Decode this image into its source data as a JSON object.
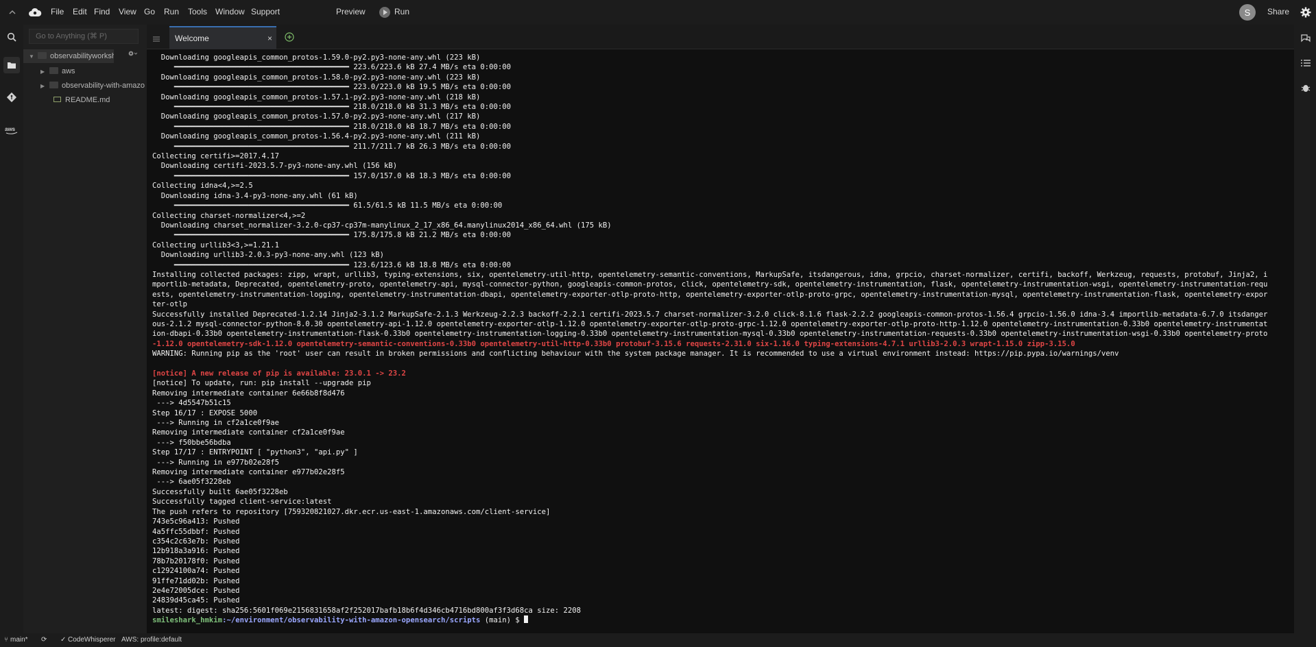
{
  "menubar": {
    "items": [
      "File",
      "Edit",
      "Find",
      "View",
      "Go",
      "Run",
      "Tools",
      "Window",
      "Support"
    ],
    "preview": "Preview",
    "run": "Run",
    "avatar_initial": "S",
    "share": "Share"
  },
  "tree": {
    "goto_placeholder": "Go to Anything (⌘ P)",
    "root": "observabilityworksh",
    "items": [
      "aws",
      "observability-with-amazo",
      "README.md"
    ]
  },
  "tabs": [
    {
      "label": "Welcome",
      "close": "×"
    }
  ],
  "terminal": {
    "lines": [
      "  Downloading googleapis_common_protos-1.59.0-py2.py3-none-any.whl (223 kB)",
      "     ━━━━━━━━━━━━━━━━━━━━━━━━━━━━━━━━━━━━━━━━ 223.6/223.6 kB 27.4 MB/s eta 0:00:00",
      "  Downloading googleapis_common_protos-1.58.0-py2.py3-none-any.whl (223 kB)",
      "     ━━━━━━━━━━━━━━━━━━━━━━━━━━━━━━━━━━━━━━━━ 223.0/223.0 kB 19.5 MB/s eta 0:00:00",
      "  Downloading googleapis_common_protos-1.57.1-py2.py3-none-any.whl (218 kB)",
      "     ━━━━━━━━━━━━━━━━━━━━━━━━━━━━━━━━━━━━━━━━ 218.0/218.0 kB 31.3 MB/s eta 0:00:00",
      "  Downloading googleapis_common_protos-1.57.0-py2.py3-none-any.whl (217 kB)",
      "     ━━━━━━━━━━━━━━━━━━━━━━━━━━━━━━━━━━━━━━━━ 218.0/218.0 kB 18.7 MB/s eta 0:00:00",
      "  Downloading googleapis_common_protos-1.56.4-py2.py3-none-any.whl (211 kB)",
      "     ━━━━━━━━━━━━━━━━━━━━━━━━━━━━━━━━━━━━━━━━ 211.7/211.7 kB 26.3 MB/s eta 0:00:00",
      "Collecting certifi>=2017.4.17",
      "  Downloading certifi-2023.5.7-py3-none-any.whl (156 kB)",
      "     ━━━━━━━━━━━━━━━━━━━━━━━━━━━━━━━━━━━━━━━━ 157.0/157.0 kB 18.3 MB/s eta 0:00:00",
      "Collecting idna<4,>=2.5",
      "  Downloading idna-3.4-py3-none-any.whl (61 kB)",
      "     ━━━━━━━━━━━━━━━━━━━━━━━━━━━━━━━━━━━━━━━━ 61.5/61.5 kB 11.5 MB/s eta 0:00:00",
      "Collecting charset-normalizer<4,>=2",
      "  Downloading charset_normalizer-3.2.0-cp37-cp37m-manylinux_2_17_x86_64.manylinux2014_x86_64.whl (175 kB)",
      "     ━━━━━━━━━━━━━━━━━━━━━━━━━━━━━━━━━━━━━━━━ 175.8/175.8 kB 21.2 MB/s eta 0:00:00",
      "Collecting urllib3<3,>=1.21.1",
      "  Downloading urllib3-2.0.3-py3-none-any.whl (123 kB)",
      "     ━━━━━━━━━━━━━━━━━━━━━━━━━━━━━━━━━━━━━━━━ 123.6/123.6 kB 18.8 MB/s eta 0:00:00",
      "Installing collected packages: zipp, wrapt, urllib3, typing-extensions, six, opentelemetry-util-http, opentelemetry-semantic-conventions, MarkupSafe, itsdangerous, idna, grpcio, charset-normalizer, certifi, backoff, Werkzeug, requests, protobuf, Jinja2, i",
      "mportlib-metadata, Deprecated, opentelemetry-proto, opentelemetry-api, mysql-connector-python, googleapis-common-protos, click, opentelemetry-sdk, opentelemetry-instrumentation, flask, opentelemetry-instrumentation-wsgi, opentelemetry-instrumentation-requ",
      "ests, opentelemetry-instrumentation-logging, opentelemetry-instrumentation-dbapi, opentelemetry-exporter-otlp-proto-http, opentelemetry-exporter-otlp-proto-grpc, opentelemetry-instrumentation-mysql, opentelemetry-instrumentation-flask, opentelemetry-expor",
      "ter-otlp",
      "Successfully installed Deprecated-1.2.14 Jinja2-3.1.2 MarkupSafe-2.1.3 Werkzeug-2.2.3 backoff-2.2.1 certifi-2023.5.7 charset-normalizer-3.2.0 click-8.1.6 flask-2.2.2 googleapis-common-protos-1.56.4 grpcio-1.56.0 idna-3.4 importlib-metadata-6.7.0 itsdanger",
      "ous-2.1.2 mysql-connector-python-8.0.30 opentelemetry-api-1.12.0 opentelemetry-exporter-otlp-1.12.0 opentelemetry-exporter-otlp-proto-grpc-1.12.0 opentelemetry-exporter-otlp-proto-http-1.12.0 opentelemetry-instrumentation-0.33b0 opentelemetry-instrumentat",
      "ion-dbapi-0.33b0 opentelemetry-instrumentation-flask-0.33b0 opentelemetry-instrumentation-logging-0.33b0 opentelemetry-instrumentation-mysql-0.33b0 opentelemetry-instrumentation-requests-0.33b0 opentelemetry-instrumentation-wsgi-0.33b0 opentelemetry-proto",
      "-1.12.0 opentelemetry-sdk-1.12.0 opentelemetry-semantic-conventions-0.33b0 opentelemetry-util-http-0.33b0 protobuf-3.15.6 requests-2.31.0 six-1.16.0 typing-extensions-4.7.1 urllib3-2.0.3 wrapt-1.15.0 zipp-3.15.0",
      "WARNING: Running pip as the 'root' user can result in broken permissions and conflicting behaviour with the system package manager. It is recommended to use a virtual environment instead: https://pip.pypa.io/warnings/venv",
      "",
      "[notice] A new release of pip is available: 23.0.1 -> 23.2",
      "[notice] To update, run: pip install --upgrade pip",
      "Removing intermediate container 6e66b8f8d476",
      " ---> 4d5547b51c15",
      "Step 16/17 : EXPOSE 5000",
      " ---> Running in cf2a1ce0f9ae",
      "Removing intermediate container cf2a1ce0f9ae",
      " ---> f50bbe56bdba",
      "Step 17/17 : ENTRYPOINT [ \"python3\", \"api.py\" ]",
      " ---> Running in e977b02e28f5",
      "Removing intermediate container e977b02e28f5",
      " ---> 6ae05f3228eb",
      "Successfully built 6ae05f3228eb",
      "Successfully tagged client-service:latest",
      "The push refers to repository [759320821027.dkr.ecr.us-east-1.amazonaws.com/client-service]",
      "743e5c96a413: Pushed",
      "4a5ffc55dbbf: Pushed",
      "c354c2c63e7b: Pushed",
      "12b918a3a916: Pushed",
      "78b7b20178f0: Pushed",
      "c12924100a74: Pushed",
      "91ffe71dd02b: Pushed",
      "2e4e72005dce: Pushed",
      "24839d45ca45: Pushed",
      "latest: digest: sha256:5601f069e2156831658af2f252017bafb18b6f4d346cb4716bd800af3f3d68ca size: 2208"
    ],
    "red_line_indices": [
      29,
      31,
      32
    ],
    "prompt": {
      "user": "smileshark_hmkim",
      "path": ":~/environment/observability-with-amazon-opensearch/scripts",
      "branch": " (main) $ "
    }
  },
  "statusbar": {
    "branch": "main*",
    "codewhisperer": "CodeWhisperer",
    "profile": "AWS: profile:default"
  },
  "colors": {
    "warning_red": "#e04545",
    "prompt_green": "#7ec07a",
    "prompt_blue": "#9aa7ff",
    "tab_accent": "#3a6fb0"
  }
}
